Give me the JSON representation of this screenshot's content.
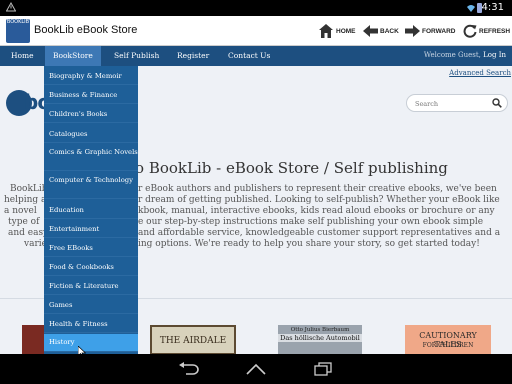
{
  "status_bar": {
    "time": "4:31"
  },
  "app_bar": {
    "title": "BookLib eBook Store",
    "icon_label": "BOOKLIB",
    "buttons": [
      {
        "label": "HOME",
        "icon": "home-icon"
      },
      {
        "label": "BACK",
        "icon": "back-arrow-icon"
      },
      {
        "label": "FORWARD",
        "icon": "forward-arrow-icon"
      },
      {
        "label": "REFRESH",
        "icon": "refresh-icon"
      }
    ]
  },
  "nav": {
    "items": [
      "Home",
      "BookStore",
      "Self Publish",
      "Register",
      "Contact Us"
    ],
    "active_index": 1,
    "welcome_prefix": "Welcome Guest,",
    "login": "Log In",
    "advanced_search": "Advanced Search"
  },
  "logo": {
    "text": "bo"
  },
  "search": {
    "placeholder": "Search"
  },
  "hero": {
    "headline_visible": "to BookLib - eBook Store / Self publishing",
    "body_lines": [
      {
        "left": "BookLib",
        "right": "r eBook authors and publishers to represent their creative ebooks, we've been"
      },
      {
        "left": "helping a",
        "right": "r dream of getting published. Looking to self-publish? Whether your eBook like"
      },
      {
        "left": "a novel",
        "right": "kbook, manual, interactive ebooks, kids read aloud ebooks or brochure or any"
      },
      {
        "left": "type of",
        "right": "e our step-by-step instructions make self publishing your own ebook simple"
      },
      {
        "left": "and easy",
        "right": "and affordable service, knowledgeable customer support representatives and a"
      },
      {
        "left": "varie",
        "right": "ing options. We're ready to help you share your story, so get started today!"
      }
    ]
  },
  "books": [
    {
      "title": "THE AIRDALE",
      "color": "#5c4a32"
    },
    {
      "title_line1": "Otto Julius Bierbaum",
      "title_line2": "Das höllische Automobil",
      "color": "#9aa3ad"
    },
    {
      "title_line1": "CAUTIONARY TALES",
      "title_line2": "FOR CHILDREN",
      "color": "#f0a888"
    }
  ],
  "dropdown": {
    "items": [
      "Biography & Memoir",
      "Business & Finance",
      "Children's Books",
      "Catalogues",
      "Comics & Graphic Novels",
      "Computer & Technology",
      "Education",
      "Entertainment",
      "Free EBooks",
      "Food & Cookbooks",
      "Fiction & Literature",
      "Games",
      "Health & Fitness",
      "History"
    ],
    "hover_index": 13
  },
  "colors": {
    "nav_bg": "#1d4f80",
    "dropdown_bg": "#1e5f98",
    "dropdown_hover": "#3ea0e8",
    "page_bg": "#eef1f6"
  }
}
